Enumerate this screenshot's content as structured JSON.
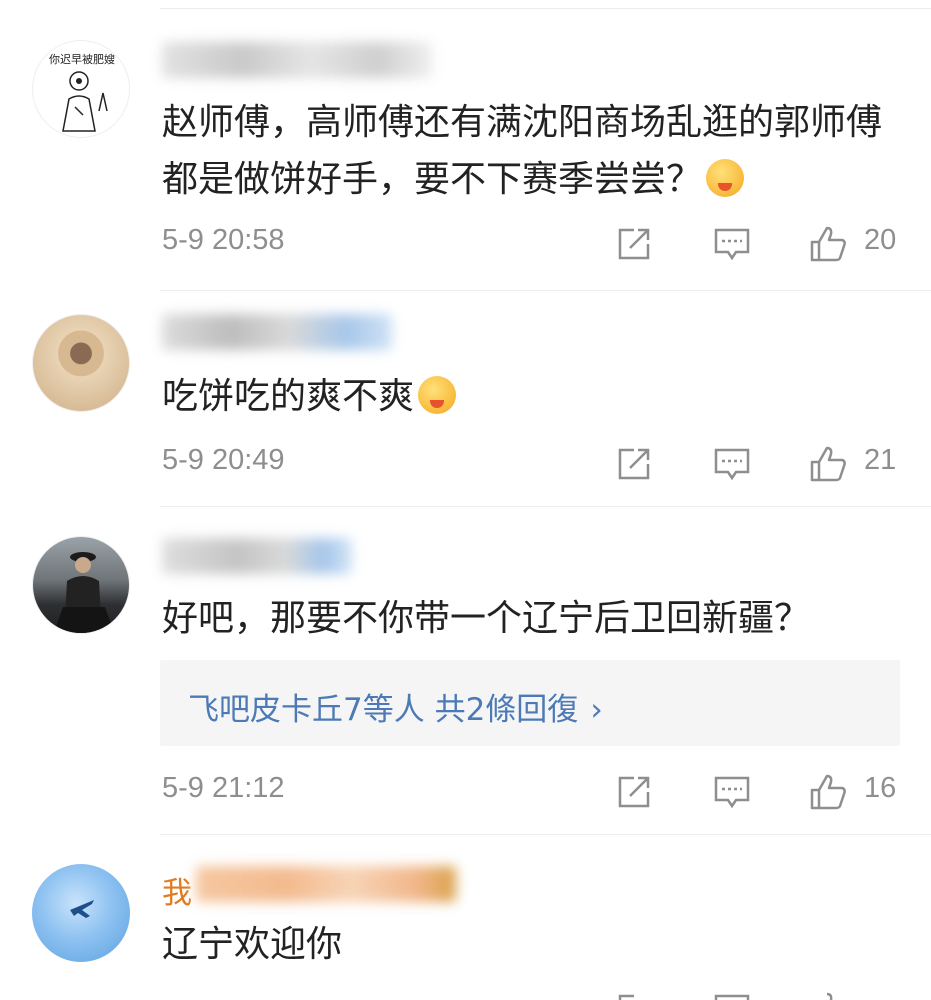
{
  "comments": [
    {
      "text": "赵师傅，高师傅还有满沈阳商场乱逛的郭师傅都是做饼好手，要不下赛季尝尝？",
      "time": "5-9 20:58",
      "likes": "20",
      "avatar_text": "你迟早被肥嫂"
    },
    {
      "text": "吃饼吃的爽不爽",
      "time": "5-9 20:49",
      "likes": "21"
    },
    {
      "text": "好吧，那要不你带一个辽宁后卫回新疆？",
      "time": "5-9 21:12",
      "likes": "16",
      "replies_label": "飞吧皮卡丘7等人 共2條回復",
      "replies_chevron": "›"
    },
    {
      "username_visible": "我",
      "text": "辽宁欢迎你"
    }
  ],
  "colors": {
    "link_blue": "#4c7ab6",
    "meta_gray": "#8e8e8e",
    "text": "#222222",
    "username_orange": "#e07b1f"
  }
}
